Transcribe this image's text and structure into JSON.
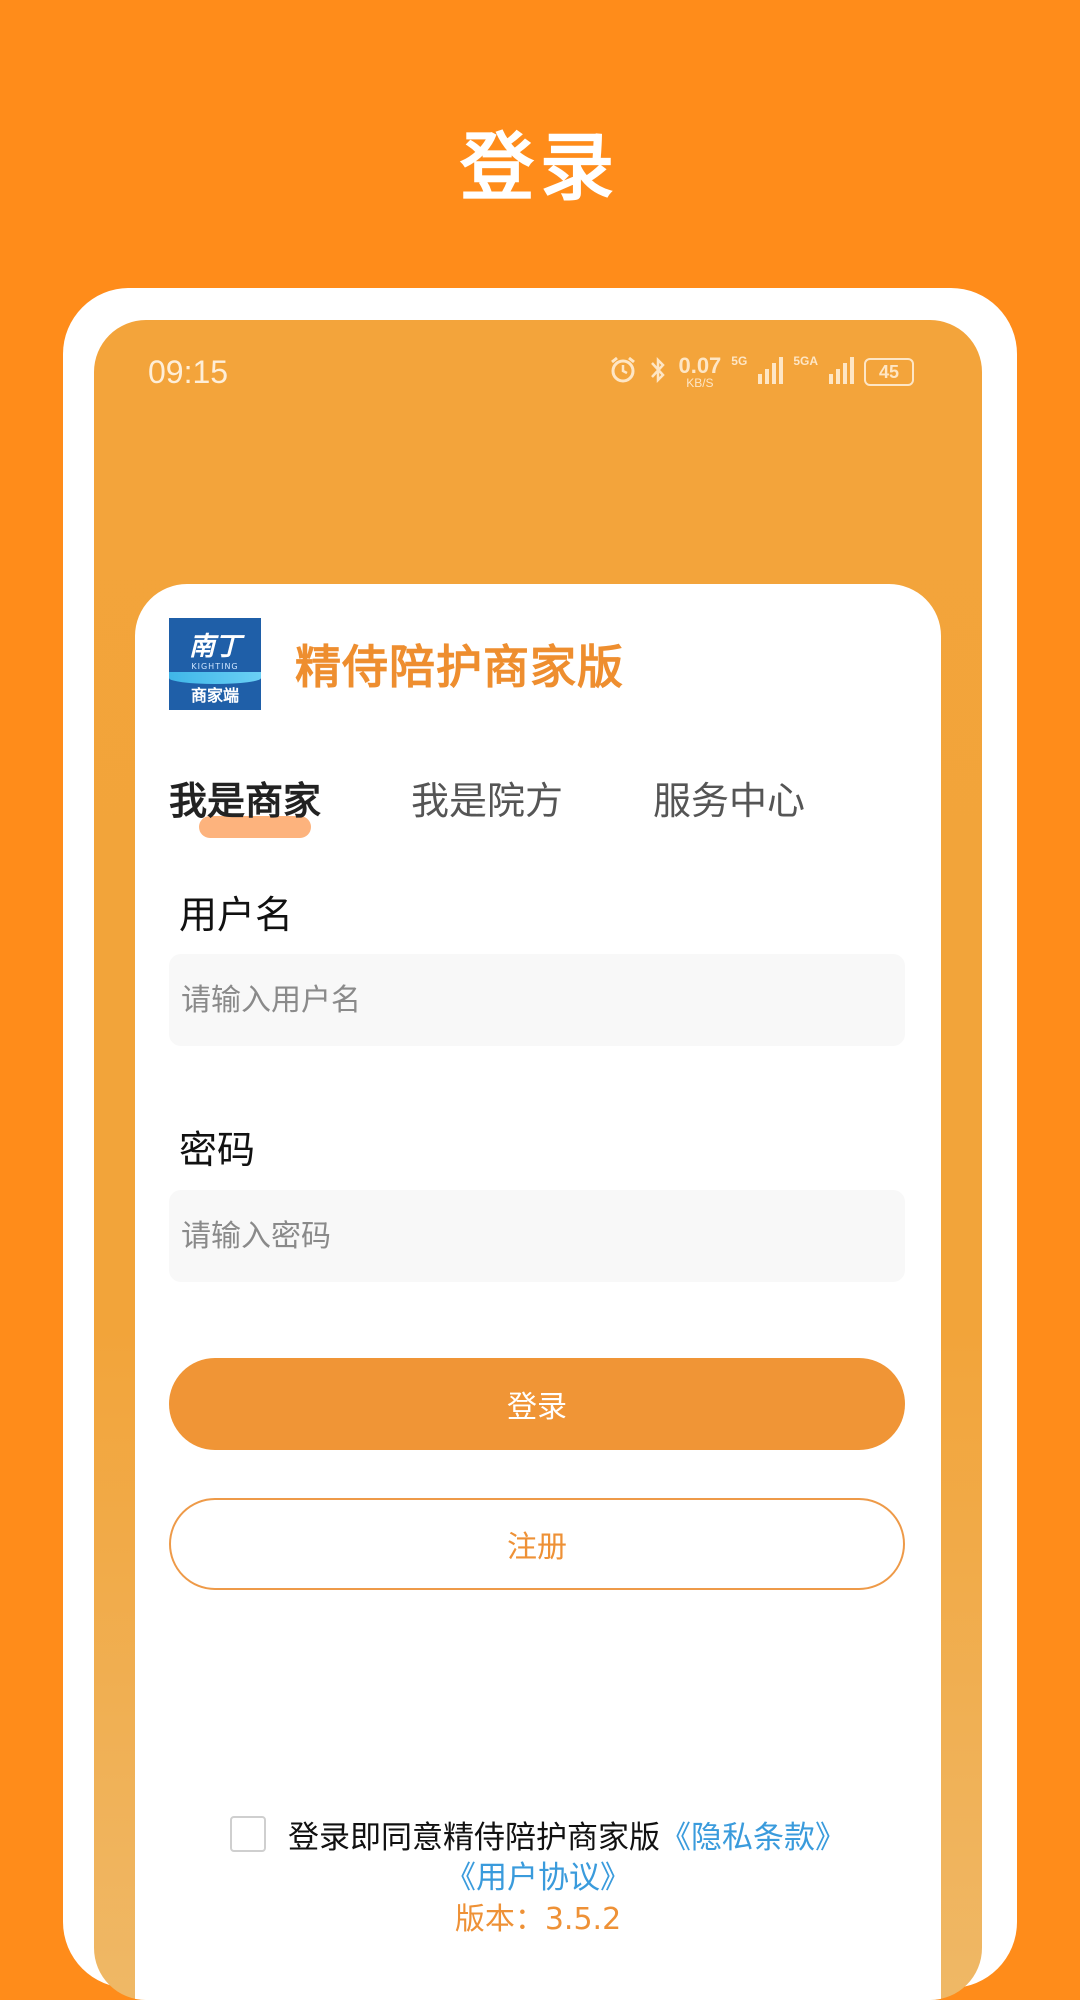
{
  "header": {
    "title": "登录"
  },
  "status_bar": {
    "time": "09:15",
    "net_speed_value": "0.07",
    "net_speed_unit": "KB/S",
    "signal1_label": "5G",
    "signal2_label": "5GA",
    "battery": "45",
    "icons": [
      "alarm-icon",
      "bluetooth-icon",
      "signal-icon",
      "signal-icon",
      "battery-icon"
    ]
  },
  "app": {
    "logo_main": "南丁",
    "logo_sub": "KIGHTING",
    "logo_bottom": "商家端",
    "name": "精侍陪护商家版"
  },
  "tabs": [
    {
      "label": "我是商家",
      "active": true
    },
    {
      "label": "我是院方",
      "active": false
    },
    {
      "label": "服务中心",
      "active": false
    }
  ],
  "form": {
    "username_label": "用户名",
    "username_placeholder": "请输入用户名",
    "username_value": "",
    "password_label": "密码",
    "password_placeholder": "请输入密码",
    "password_value": ""
  },
  "buttons": {
    "login": "登录",
    "register": "注册"
  },
  "agreement": {
    "checked": false,
    "text": "登录即同意精侍陪护商家版",
    "privacy_link": "《隐私条款》",
    "user_agreement_link": "《用户协议》"
  },
  "version": "版本：3.5.2",
  "colors": {
    "background": "#FF8C1A",
    "accent": "#F09536",
    "link": "#3A9BDC"
  }
}
